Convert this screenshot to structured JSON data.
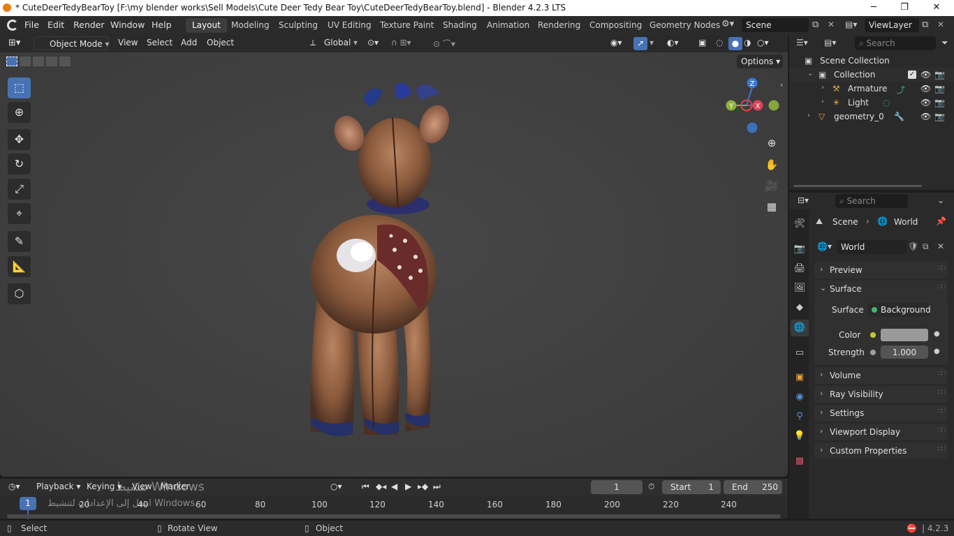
{
  "titlebar": {
    "title": "* CuteDeerTedyBearToy [F:\\my blender works\\Sell Models\\Cute Deer Tedy Bear Toy\\CuteDeerTedyBearToy.blend] - Blender 4.2.3 LTS",
    "minimize": "─",
    "maximize": "❐",
    "close": "✕"
  },
  "menu": {
    "file": "File",
    "edit": "Edit",
    "render": "Render",
    "window": "Window",
    "help": "Help"
  },
  "workspaces": [
    "Layout",
    "Modeling",
    "Sculpting",
    "UV Editing",
    "Texture Paint",
    "Shading",
    "Animation",
    "Rendering",
    "Compositing",
    "Geometry Nodes"
  ],
  "scene": {
    "scene_name": "Scene",
    "view_layer": "ViewLayer"
  },
  "viewport_header": {
    "mode": "Object Mode",
    "view": "View",
    "select": "Select",
    "add": "Add",
    "object": "Object",
    "orientation": "Global",
    "options": "Options"
  },
  "gizmo": {
    "z": "Z",
    "y": "Y",
    "x": "X"
  },
  "outliner": {
    "search_placeholder": "Search",
    "scene_collection": "Scene Collection",
    "collection": "Collection",
    "armature": "Armature",
    "light": "Light",
    "geometry": "geometry_0"
  },
  "properties": {
    "search_placeholder": "Search",
    "breadcrumb_scene": "Scene",
    "breadcrumb_world": "World",
    "world_name": "World",
    "panels": {
      "preview": "Preview",
      "surface": "Surface",
      "volume": "Volume",
      "ray_visibility": "Ray Visibility",
      "settings": "Settings",
      "viewport_display": "Viewport Display",
      "custom_properties": "Custom Properties"
    },
    "surface_label": "Surface",
    "surface_value": "Background",
    "color_label": "Color",
    "strength_label": "Strength",
    "strength_value": "1.000"
  },
  "timeline": {
    "playback": "Playback",
    "keying": "Keying",
    "view": "View",
    "marker": "Marker",
    "current_frame": "1",
    "start_label": "Start",
    "start_value": "1",
    "end_label": "End",
    "end_value": "250",
    "playhead": "1",
    "ticks": [
      "20",
      "40",
      "60",
      "80",
      "100",
      "120",
      "140",
      "160",
      "180",
      "200",
      "220",
      "240"
    ]
  },
  "watermark": {
    "line1": "تنشيط Windows",
    "line2": "انتقل إلى الإعدادات لتنشيط Windows."
  },
  "statusbar": {
    "select": "Select",
    "rotate": "Rotate View",
    "object": "Object",
    "version": "4.2.3"
  },
  "colors": {
    "accent": "#4772b3",
    "panel_bg": "#2a2a2a",
    "viewport_bg": "#404040",
    "gizmo_x": "#d9435a",
    "gizmo_y": "#8bb33a",
    "gizmo_z": "#3c79cf",
    "orange": "#e87d0d"
  }
}
